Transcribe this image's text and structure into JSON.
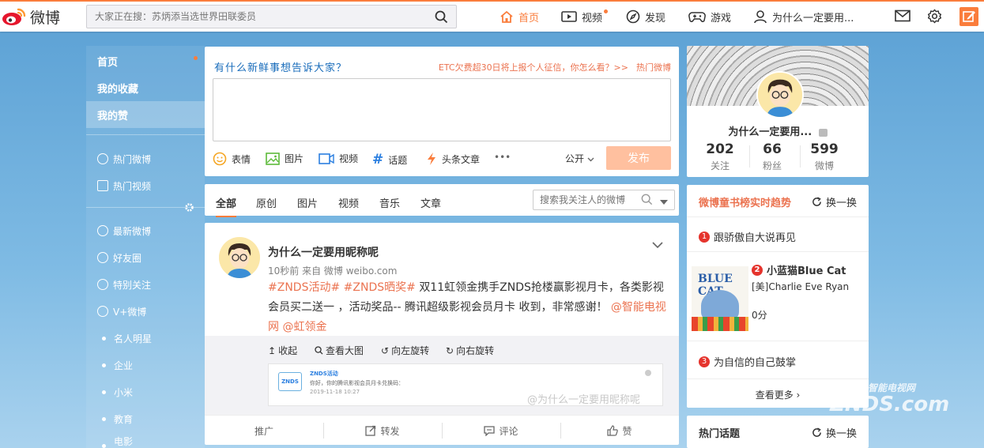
{
  "header": {
    "logo_text": "微博",
    "search_placeholder": "大家正在搜：苏炳添当选世界田联委员",
    "nav": [
      {
        "label": "首页",
        "icon": "home-icon"
      },
      {
        "label": "视频",
        "icon": "video-icon"
      },
      {
        "label": "发现",
        "icon": "compass-icon"
      },
      {
        "label": "游戏",
        "icon": "gamepad-icon"
      },
      {
        "label": "为什么一定要用...",
        "icon": "user-icon"
      }
    ]
  },
  "sidebar": {
    "items": [
      "首页",
      "我的收藏",
      "我的赞",
      "热门微博",
      "热门视频",
      "最新微博",
      "好友圈",
      "特别关注",
      "V+微博",
      "名人明星",
      "企业",
      "小米",
      "教育",
      "电影"
    ]
  },
  "compose": {
    "title": "有什么新鲜事想告诉大家？",
    "hot_text": "ETC欠费超30日将上报个人征信，你怎么看？>>",
    "hot_link": "热门微博",
    "tools": [
      "表情",
      "图片",
      "视频",
      "话题",
      "头条文章"
    ],
    "more": "•••",
    "visibility": "公开",
    "send_label": "发布"
  },
  "feed": {
    "tabs": [
      "全部",
      "原创",
      "图片",
      "视频",
      "音乐",
      "文章"
    ],
    "search_placeholder": "搜索我关注人的微博"
  },
  "post": {
    "author": "为什么一定要用昵称呢",
    "meta": "10秒前 来自 微博 weibo.com",
    "tag1": "#ZNDS活动#",
    "tag2": "#ZNDS晒奖#",
    "text": " 双11虹领金携手ZNDS抢楼赢影视月卡，各类影视会员买二送一 ，活动奖品-- 腾讯超级影视会员月卡 收到，非常感谢！",
    "mention1": "@智能电视网",
    "mention2": "@虹领金",
    "image_actions": [
      "收起",
      "查看大图",
      "向左旋转",
      "向右旋转"
    ],
    "mini_title": "ZNDS活动",
    "mini_text": "你好，你的腾讯影视会员月卡兑换码：",
    "mini_time": "2019-11-18 10:27",
    "mini_logo": "ZNDS",
    "watermark": "@为什么一定要用昵称呢",
    "actions": [
      "推广",
      "转发",
      "评论",
      "赞"
    ]
  },
  "profile": {
    "name": "为什么一定要用...",
    "stats": [
      {
        "num": "202",
        "label": "关注"
      },
      {
        "num": "66",
        "label": "粉丝"
      },
      {
        "num": "599",
        "label": "微博"
      }
    ]
  },
  "trends": {
    "title": "微博童书榜实时趋势",
    "refresh": "换一换",
    "items": [
      {
        "rank": "1",
        "title": "跟骄傲自大说再见"
      },
      {
        "rank": "2",
        "title": "小蓝猫Blue Cat",
        "author": "[美]Charlie Eve Ryan",
        "score": "0分",
        "cover_text": "BLUE CAT"
      },
      {
        "rank": "3",
        "title": "为自信的自己鼓掌"
      }
    ],
    "more": "查看更多 ›"
  },
  "hot_topics": {
    "title": "热门话题",
    "refresh": "换一换"
  },
  "corner_watermark": "ZNDS.com",
  "corner_watermark_sub": "智能电视网",
  "colors": {
    "accent": "#fa7d3c",
    "link": "#eb7350",
    "bg": "#6aaedc"
  }
}
